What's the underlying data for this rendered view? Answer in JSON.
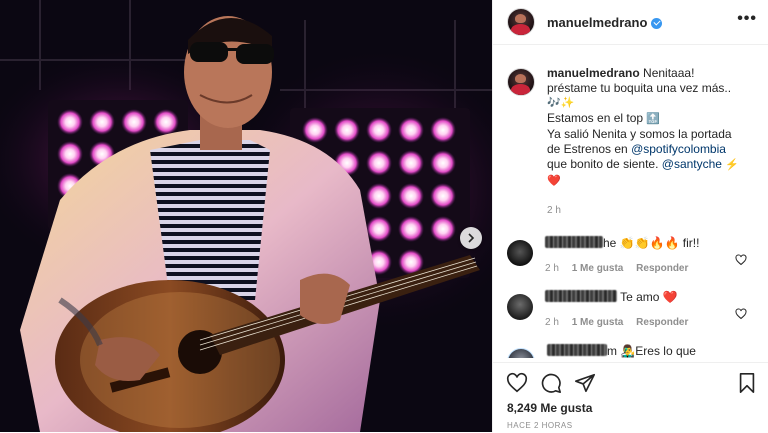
{
  "post": {
    "author": "manuelmedrano",
    "photo_alt": "Man with sunglasses playing acoustic guitar in front of pink stage lights"
  },
  "caption": {
    "author": "manuelmedrano",
    "line1": "Nenitaaa!",
    "line2": "préstame tu boquita una vez más..",
    "line2_emoji": "🎶✨",
    "line3": "Estamos en el top ",
    "line3_emoji": "🔝",
    "line4": "Ya salió Nenita y somos la portada de Estrenos en ",
    "mention1": "@spotifycolombia",
    "line4b": " que bonito de siente. ",
    "mention2": "@santyche",
    "line4_emoji": " ⚡❤️",
    "time": "2 h"
  },
  "comments": [
    {
      "text_tail": "he 👏👏🔥🔥 fir!!",
      "time": "2 h",
      "likes": "1 Me gusta",
      "reply": "Responder",
      "avatar_color": "#1e1e1e"
    },
    {
      "text_tail": " Te amo ❤️",
      "time": "2 h",
      "likes": "1 Me gusta",
      "reply": "Responder",
      "avatar_color": "#2b2b2b"
    },
    {
      "text_tail": "m 👨‍🎤Eres lo que siempre quise 👨‍🎤🥰😘🔥",
      "time": "",
      "likes": "",
      "reply": "",
      "avatar_color": "#3a3f4a"
    }
  ],
  "actions": {
    "likes": "8,249 Me gusta",
    "time": "HACE 2 HORAS",
    "icons": [
      "heart-icon",
      "comment-icon",
      "share-icon",
      "bookmark-icon"
    ]
  },
  "colors": {
    "link": "#00376b",
    "verified": "#3897f0",
    "muted": "#8e8e8e"
  }
}
